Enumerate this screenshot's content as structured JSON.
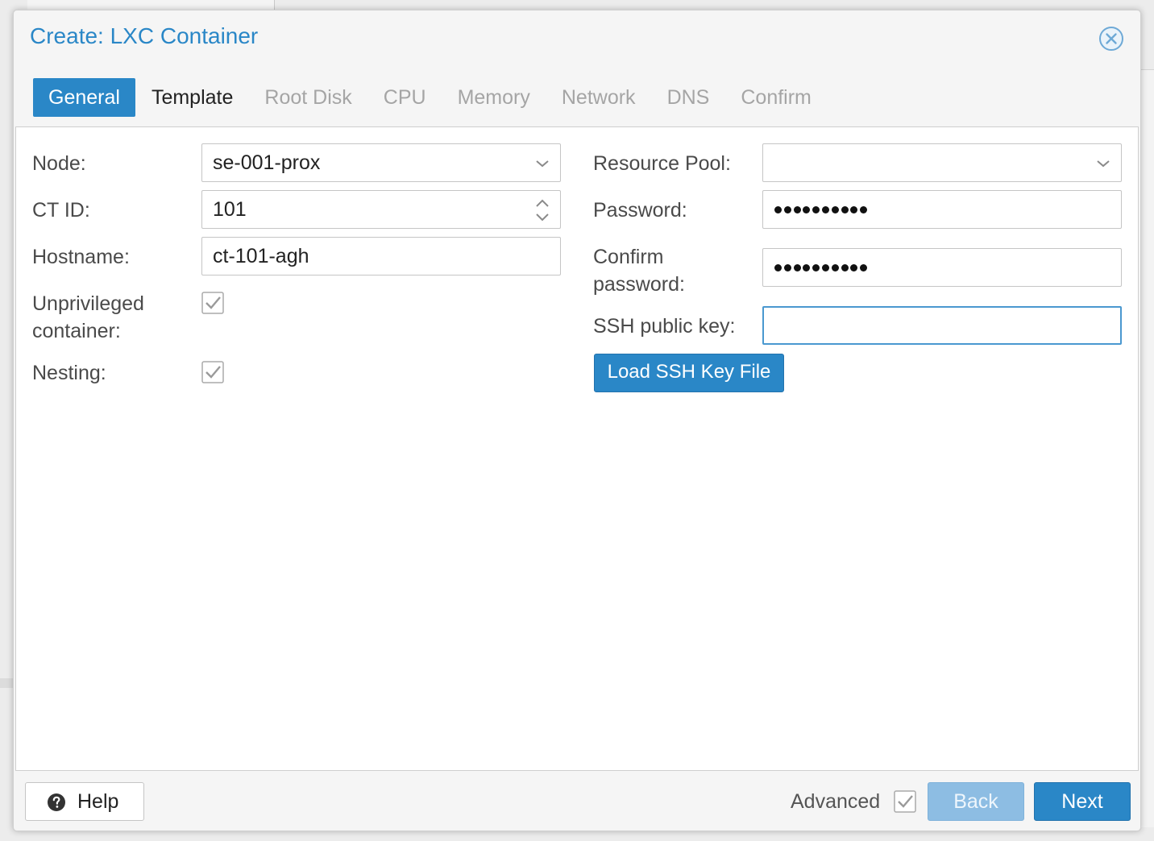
{
  "dialog": {
    "title": "Create: LXC Container",
    "accent_color": "#2a87c7"
  },
  "tabs": [
    {
      "label": "General",
      "state": "active"
    },
    {
      "label": "Template",
      "state": "enabled"
    },
    {
      "label": "Root Disk",
      "state": "disabled"
    },
    {
      "label": "CPU",
      "state": "disabled"
    },
    {
      "label": "Memory",
      "state": "disabled"
    },
    {
      "label": "Network",
      "state": "disabled"
    },
    {
      "label": "DNS",
      "state": "disabled"
    },
    {
      "label": "Confirm",
      "state": "disabled"
    }
  ],
  "left": {
    "node": {
      "label": "Node:",
      "value": "se-001-prox"
    },
    "ctid": {
      "label": "CT ID:",
      "value": "101"
    },
    "hostname": {
      "label": "Hostname:",
      "value": "ct-101-agh"
    },
    "unprivileged": {
      "label_line1": "Unprivileged",
      "label_line2": "container:",
      "checked": true
    },
    "nesting": {
      "label": "Nesting:",
      "checked": true
    }
  },
  "right": {
    "resource_pool": {
      "label": "Resource Pool:",
      "value": ""
    },
    "password": {
      "label": "Password:",
      "length": 10
    },
    "confirm_password": {
      "label_line1": "Confirm",
      "label_line2": "password:",
      "length": 10
    },
    "ssh_key": {
      "label": "SSH public key:",
      "value": ""
    },
    "load_ssh_button": "Load SSH Key File"
  },
  "footer": {
    "help": "Help",
    "advanced": "Advanced",
    "advanced_checked": true,
    "back": "Back",
    "next": "Next"
  },
  "icons": {
    "close": "close-circle-icon",
    "help": "question-circle-icon",
    "dropdown": "chevron-down-icon",
    "spinner": "spinner-arrows-icon",
    "checkbox": "checkbox-checked-icon"
  }
}
